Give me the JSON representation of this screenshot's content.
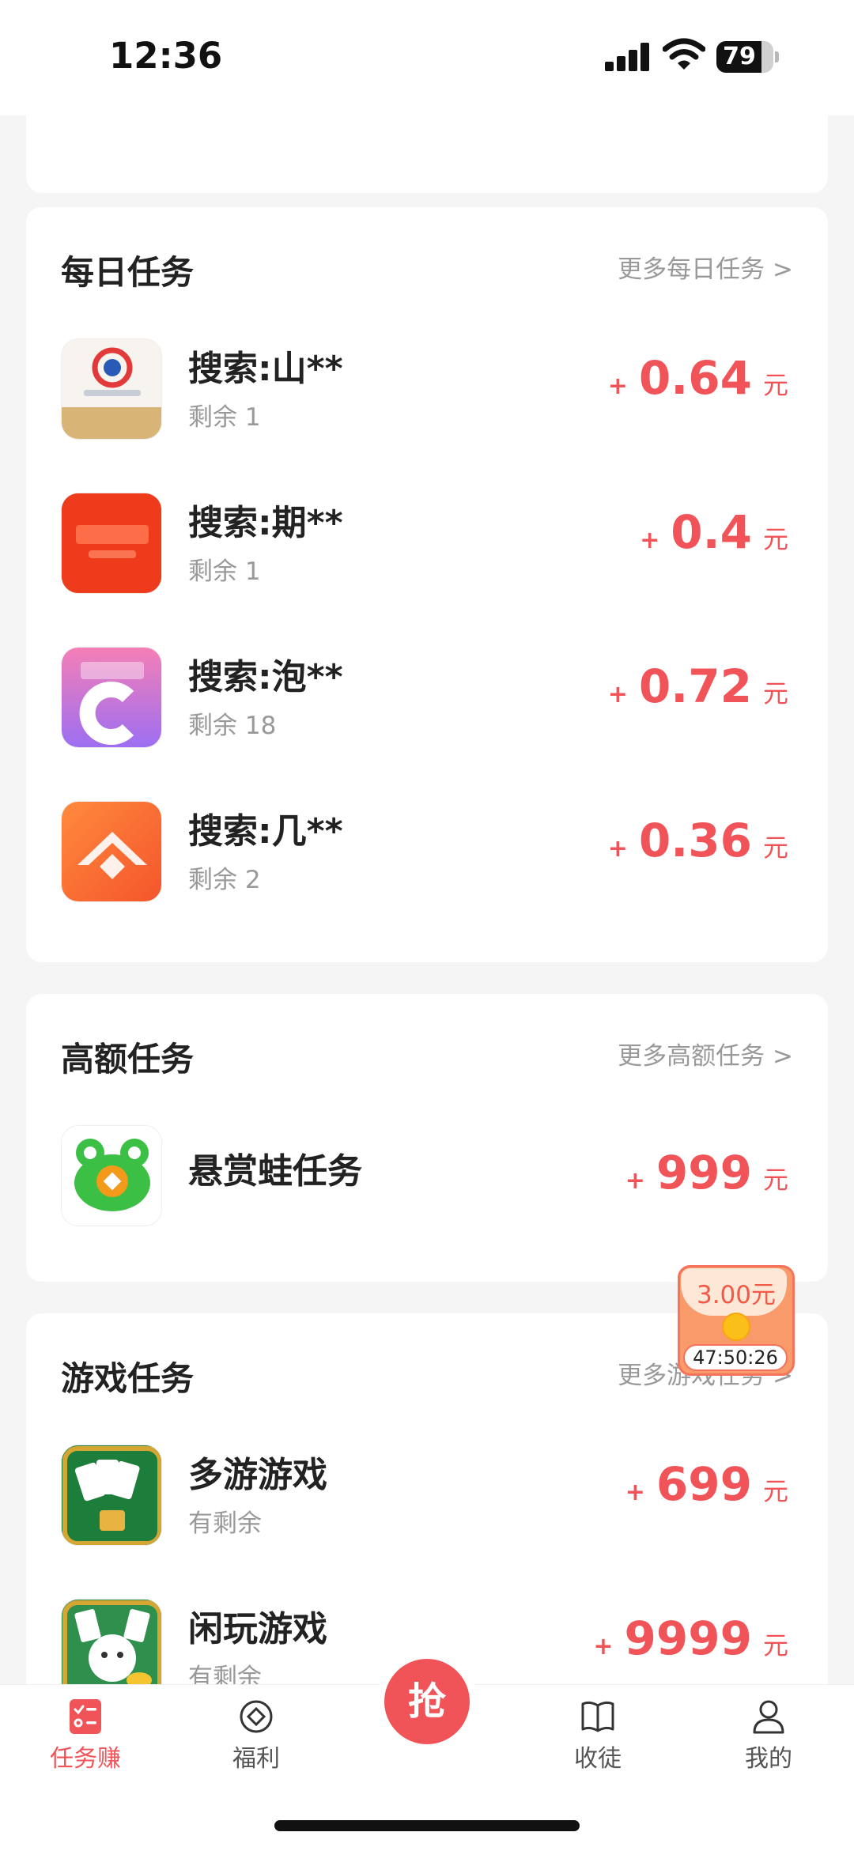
{
  "status_bar": {
    "time": "12:36",
    "battery": "79",
    "battery_level": 0.79
  },
  "daily_tasks": {
    "title": "每日任务",
    "more": "更多每日任务 >",
    "items": [
      {
        "name": "搜索:山**",
        "sub": "剩余 1",
        "plus": "+",
        "amount": "0.64",
        "unit": "元",
        "icon": "bank-app-icon"
      },
      {
        "name": "搜索:期**",
        "sub": "剩余 1",
        "plus": "+",
        "amount": "0.4",
        "unit": "元",
        "icon": "futures-app-icon"
      },
      {
        "name": "搜索:泡**",
        "sub": "剩余 18",
        "plus": "+",
        "amount": "0.72",
        "unit": "元",
        "icon": "pao-app-icon"
      },
      {
        "name": "搜索:几**",
        "sub": "剩余 2",
        "plus": "+",
        "amount": "0.36",
        "unit": "元",
        "icon": "ji-app-icon"
      }
    ]
  },
  "high_tasks": {
    "title": "高额任务",
    "more": "更多高额任务 >",
    "items": [
      {
        "name": "悬赏蛙任务",
        "plus": "+",
        "amount": "999",
        "unit": "元",
        "icon": "frog-app-icon"
      }
    ]
  },
  "game_tasks": {
    "title": "游戏任务",
    "more": "更多游戏任务 >",
    "items": [
      {
        "name": "多游游戏",
        "sub": "有剩余",
        "plus": "+",
        "amount": "699",
        "unit": "元",
        "icon": "cards-game-icon"
      },
      {
        "name": "闲玩游戏",
        "sub": "有剩余",
        "plus": "+",
        "amount": "9999",
        "unit": "元",
        "icon": "lucky-cat-game-icon"
      }
    ]
  },
  "red_packet": {
    "amount": "3.00元",
    "countdown": "47:50:26"
  },
  "tab_bar": {
    "items": [
      {
        "label": "任务赚",
        "icon": "task-list-icon",
        "active": true
      },
      {
        "label": "福利",
        "icon": "diamond-icon"
      },
      {
        "label": "抢",
        "icon": "grab-button"
      },
      {
        "label": "收徒",
        "icon": "book-icon"
      },
      {
        "label": "我的",
        "icon": "person-icon"
      }
    ]
  },
  "colors": {
    "accent": "#f15458",
    "muted": "#999999",
    "background": "#f5f5f5"
  }
}
